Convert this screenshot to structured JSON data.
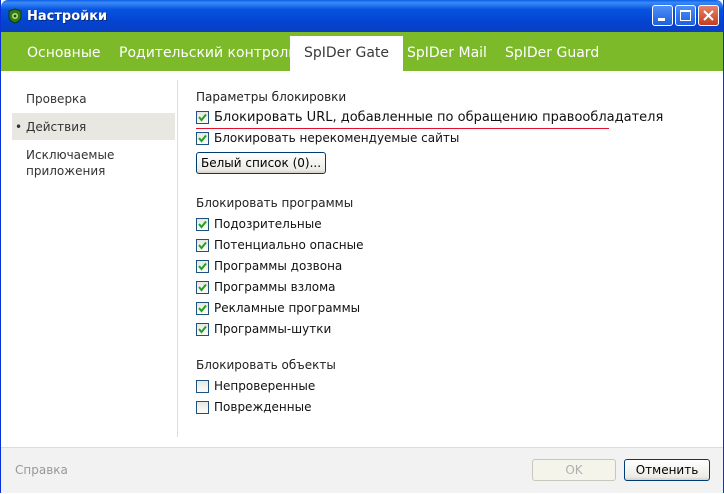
{
  "window": {
    "title": "Настройки"
  },
  "tabs": [
    {
      "label": "Основные"
    },
    {
      "label": "Родительский контроль"
    },
    {
      "label": "SpIDer Gate"
    },
    {
      "label": "SpIDer Mail"
    },
    {
      "label": "SpIDer Guard"
    }
  ],
  "active_tab": "SpIDer Gate",
  "nav": {
    "bullet": "•",
    "items": [
      {
        "label": "Проверка"
      },
      {
        "label": "Действия"
      },
      {
        "label": "Исключаемые\nприложения"
      }
    ],
    "active": "Действия"
  },
  "blocking": {
    "title": "Параметры блокировки",
    "items": [
      {
        "label": "Блокировать URL, добавленные по обращению правообладателя",
        "checked": true
      },
      {
        "label": "Блокировать нерекомендуемые сайты",
        "checked": true
      }
    ],
    "whitelist_button": "Белый список (0)..."
  },
  "programs": {
    "title": "Блокировать программы",
    "items": [
      {
        "label": "Подозрительные",
        "checked": true
      },
      {
        "label": "Потенциально опасные",
        "checked": true
      },
      {
        "label": "Программы дозвона",
        "checked": true
      },
      {
        "label": "Программы взлома",
        "checked": true
      },
      {
        "label": "Рекламные программы",
        "checked": true
      },
      {
        "label": "Программы-шутки",
        "checked": true
      }
    ]
  },
  "objects": {
    "title": "Блокировать объекты",
    "items": [
      {
        "label": "Непроверенные",
        "checked": false
      },
      {
        "label": "Поврежденные",
        "checked": false
      }
    ]
  },
  "footer": {
    "help": "Справка",
    "ok": "OK",
    "cancel": "Отменить"
  },
  "colors": {
    "accent_green": "#7dba2a",
    "underline_red": "#e0122f",
    "titlebar_blue": "#0753e1"
  }
}
